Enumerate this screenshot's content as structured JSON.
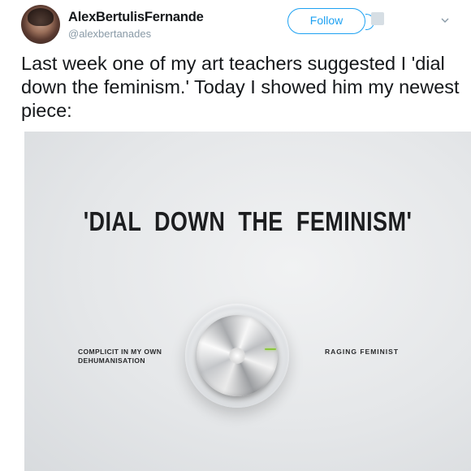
{
  "header": {
    "display_name": "AlexBertulisFernande",
    "handle": "@alexbertanades",
    "follow_label": "Follow"
  },
  "tweet": {
    "text": "Last week one of my art teachers suggested I 'dial down the feminism.' Today I showed him my newest piece:"
  },
  "artwork": {
    "title": "'DIAL DOWN THE FEMINISM'",
    "dial_left_label": "COMPLICIT IN MY OWN DEHUMANISATION",
    "dial_right_label": "RAGING FEMINIST",
    "indicator_color": "#8cc63f"
  },
  "colors": {
    "accent": "#1da1f2",
    "text": "#14171a",
    "secondary_text": "#8899a6"
  },
  "icons": {
    "menu": "chevron-down-icon",
    "follow_extra": "add-user-icon"
  }
}
